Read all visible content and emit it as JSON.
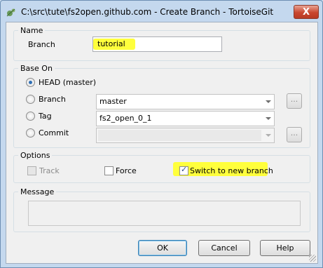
{
  "window": {
    "title": "C:\\src\\tute\\fs2open.github.com - Create Branch - TortoiseGit",
    "close_label": "X"
  },
  "name_group": {
    "label": "Name",
    "branch_label": "Branch",
    "branch_value": "tutorial"
  },
  "base_on": {
    "label": "Base On",
    "head_label": "HEAD (master)",
    "branch_label": "Branch",
    "branch_value": "master",
    "tag_label": "Tag",
    "tag_value": "fs2_open_0_1",
    "commit_label": "Commit",
    "commit_value": "",
    "browse_label": "...",
    "selected": "HEAD (master)"
  },
  "options": {
    "label": "Options",
    "track_label": "Track",
    "track_checked": false,
    "force_label": "Force",
    "force_checked": false,
    "switch_label": "Switch to new branch",
    "switch_checked": true
  },
  "message": {
    "label": "Message",
    "value": ""
  },
  "buttons": {
    "ok": "OK",
    "cancel": "Cancel",
    "help": "Help"
  },
  "colors": {
    "highlight": "#ffff3c",
    "title_bar": "#c4d8ee"
  }
}
